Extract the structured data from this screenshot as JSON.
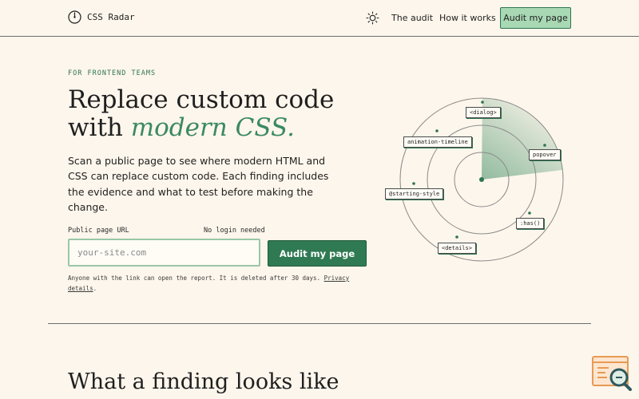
{
  "header": {
    "brand": "CSS Radar",
    "nav": {
      "audit": "The audit",
      "how": "How it works"
    },
    "cta": "Audit my page"
  },
  "hero": {
    "eyebrow": "FOR FRONTEND TEAMS",
    "title_line1": "Replace custom code",
    "title_with": "with",
    "title_accent": "modern CSS.",
    "description": "Scan a public page to see where modern HTML and CSS can replace custom code. Each finding includes the evidence and what to test before making the change.",
    "url_label": "Public page URL",
    "no_login": "No login needed",
    "url_placeholder": "your-site.com",
    "url_value": "",
    "submit": "Audit my page",
    "fineprint": "Anyone with the link can open the report. It is deleted after 30 days.",
    "privacy_link": "Privacy details",
    "period": "."
  },
  "radar": {
    "tags": {
      "dialog": "<dialog>",
      "animation_timeline": "animation-timeline",
      "popover": "popover",
      "starting_style": "@starting-style",
      "has": ":has()",
      "details": "<details>"
    }
  },
  "section": {
    "title": "What a finding looks like"
  },
  "colors": {
    "background": "#fdf6ec",
    "accent": "#2f7a53",
    "accent_light": "#a8d8b4",
    "accent_text": "#3a8a60"
  },
  "icons": {
    "brand": "radar-logo-icon",
    "theme": "sun-icon",
    "widget": "search-report-icon"
  }
}
